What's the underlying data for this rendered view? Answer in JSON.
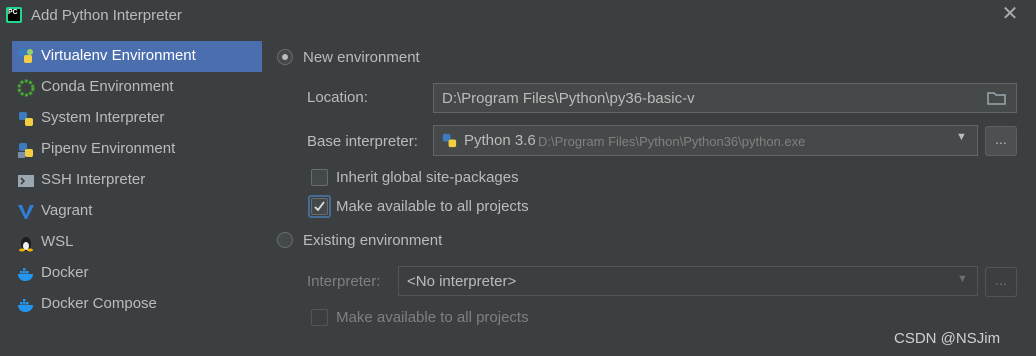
{
  "window": {
    "title": "Add Python Interpreter"
  },
  "sidebar": {
    "items": [
      {
        "label": "Virtualenv Environment",
        "icon": "virtualenv-icon",
        "selected": true
      },
      {
        "label": "Conda Environment",
        "icon": "conda-icon"
      },
      {
        "label": "System Interpreter",
        "icon": "python-icon"
      },
      {
        "label": "Pipenv Environment",
        "icon": "pipenv-icon"
      },
      {
        "label": "SSH Interpreter",
        "icon": "ssh-icon"
      },
      {
        "label": "Vagrant",
        "icon": "vagrant-icon"
      },
      {
        "label": "WSL",
        "icon": "linux-icon"
      },
      {
        "label": "Docker",
        "icon": "docker-icon"
      },
      {
        "label": "Docker Compose",
        "icon": "docker-compose-icon"
      }
    ]
  },
  "new_env": {
    "label": "New environment",
    "location_label": "Location:",
    "location_value": "D:\\Program Files\\Python\\py36-basic-v",
    "base_label": "Base interpreter:",
    "base_version": "Python 3.6",
    "base_path": "D:\\Program Files\\Python\\Python36\\python.exe",
    "browse": "...",
    "inherit_label": "Inherit global site-packages",
    "make_available_label": "Make available to all projects"
  },
  "existing_env": {
    "label": "Existing environment",
    "interpreter_label": "Interpreter:",
    "interpreter_value": "<No interpreter>",
    "browse": "...",
    "make_available_label": "Make available to all projects"
  },
  "watermark": "CSDN @NSJim"
}
